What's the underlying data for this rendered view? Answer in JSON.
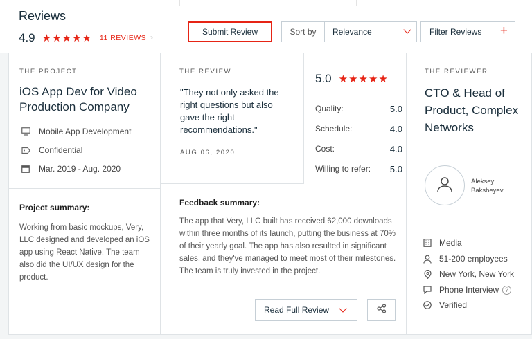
{
  "header": {
    "title": "Reviews",
    "rating": "4.9",
    "stars": "★★★★★",
    "reviews_link": "11 REVIEWS",
    "reviews_chevron": "›",
    "submit_label": "Submit Review",
    "sort_label": "Sort by",
    "sort_value": "Relevance",
    "filter_label": "Filter Reviews",
    "filter_plus": "+"
  },
  "project": {
    "caption": "THE PROJECT",
    "title": "iOS App Dev for Video Production Company",
    "service": "Mobile App Development",
    "budget": "Confidential",
    "dates": "Mar. 2019 - Aug. 2020",
    "summary_heading": "Project summary:",
    "summary": "Working from basic mockups, Very, LLC designed and developed an iOS app using React Native. The team also did the UI/UX design for the product."
  },
  "review": {
    "caption": "THE REVIEW",
    "quote": "\"They not only asked the right questions but also gave the right recommendations.\"",
    "date": "AUG 06, 2020",
    "score": "5.0",
    "stars": "★★★★★",
    "ratings": [
      {
        "label": "Quality:",
        "value": "5.0"
      },
      {
        "label": "Schedule:",
        "value": "4.0"
      },
      {
        "label": "Cost:",
        "value": "4.0"
      },
      {
        "label": "Willing to refer:",
        "value": "5.0"
      }
    ],
    "feedback_heading": "Feedback summary:",
    "feedback": "The app that Very, LLC built has received 62,000 downloads within three months of its launch, putting the business at 70% of their yearly goal. The app has also resulted in significant sales, and they've managed to meet most of their milestones. The team is truly invested in the project.",
    "read_full_label": "Read Full Review"
  },
  "reviewer": {
    "caption": "THE REVIEWER",
    "role": "CTO & Head of Product, Complex Networks",
    "name_line1": "Aleksey",
    "name_line2": "Baksheyev",
    "industry": "Media",
    "size": "51-200 employees",
    "location": "New York, New York",
    "interview": "Phone Interview",
    "verified": "Verified",
    "help_glyph": "?"
  },
  "colors": {
    "accent": "#e62415",
    "text_dark": "#1a2e3b",
    "border": "#c6cfd6"
  },
  "icons": [
    "monitor-icon",
    "tag-icon",
    "calendar-icon",
    "user-icon",
    "building-icon",
    "person-icon",
    "location-pin-icon",
    "speech-bubble-icon",
    "check-circle-icon",
    "share-icon",
    "chevron-down-icon",
    "plus-icon"
  ]
}
